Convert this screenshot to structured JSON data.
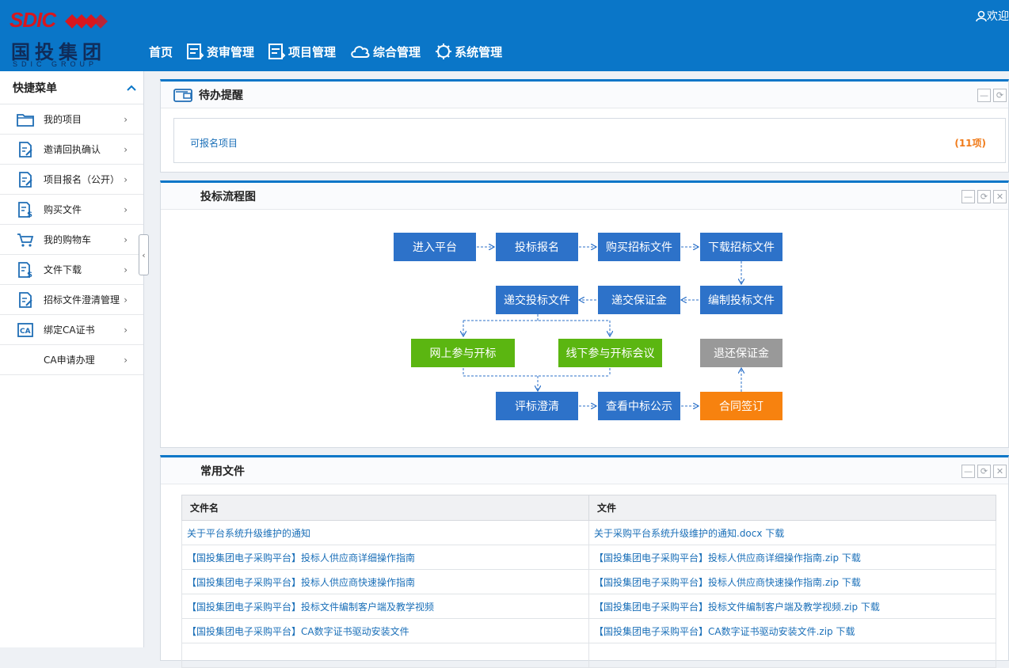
{
  "brand": {
    "name_en": "SDIC",
    "name_cn": "国投集团",
    "sub": "SDIC GROUP"
  },
  "header": {
    "nav": [
      {
        "label": "首页",
        "icon": ""
      },
      {
        "label": "资审管理",
        "icon": "list-icon"
      },
      {
        "label": "项目管理",
        "icon": "list-icon"
      },
      {
        "label": "综合管理",
        "icon": "cloud-icon"
      },
      {
        "label": "系统管理",
        "icon": "gear-icon"
      }
    ],
    "welcome": "欢迎"
  },
  "sidebar": {
    "title": "快捷菜单",
    "items": [
      {
        "label": "我的项目",
        "icon": "folder-icon"
      },
      {
        "label": "邀请回执确认",
        "icon": "edit-doc-icon"
      },
      {
        "label": "项目报名（公开）",
        "icon": "edit-doc-icon"
      },
      {
        "label": "购买文件",
        "icon": "dollar-doc-icon"
      },
      {
        "label": "我的购物车",
        "icon": "cart-icon"
      },
      {
        "label": "文件下载",
        "icon": "dollar-doc-icon"
      },
      {
        "label": "招标文件澄清管理",
        "icon": "edit-doc-icon"
      },
      {
        "label": "绑定CA证书",
        "icon": "ca-icon"
      },
      {
        "label": "CA申请办理",
        "icon": ""
      }
    ]
  },
  "todo": {
    "title": "待办提醒",
    "link": "可报名项目",
    "count": "(11项)"
  },
  "flow": {
    "title": "投标流程图",
    "steps": {
      "s1": "进入平台",
      "s2": "投标报名",
      "s3": "购买招标文件",
      "s4": "下载招标文件",
      "s5": "编制投标文件",
      "s6": "递交保证金",
      "s7": "递交投标文件",
      "s8": "网上参与开标",
      "s9": "线下参与开标会议",
      "s10": "退还保证金",
      "s11": "评标澄清",
      "s12": "查看中标公示",
      "s13": "合同签订"
    },
    "colors": {
      "blue": "#2d72c9",
      "green": "#5bb611",
      "gray": "#999999",
      "orange": "#f7820f"
    }
  },
  "files": {
    "title": "常用文件",
    "columns": [
      "文件名",
      "文件"
    ],
    "rows": [
      [
        "关于平台系统升级维护的通知",
        "关于采购平台系统升级维护的通知.docx 下载"
      ],
      [
        "【国投集团电子采购平台】投标人供应商详细操作指南",
        "【国投集团电子采购平台】投标人供应商详细操作指南.zip 下载"
      ],
      [
        "【国投集团电子采购平台】投标人供应商快速操作指南",
        "【国投集团电子采购平台】投标人供应商快速操作指南.zip 下载"
      ],
      [
        "【国投集团电子采购平台】投标文件编制客户端及教学视频",
        "【国投集团电子采购平台】投标文件编制客户端及教学视频.zip 下载"
      ],
      [
        "【国投集团电子采购平台】CA数字证书驱动安装文件",
        "【国投集团电子采购平台】CA数字证书驱动安装文件.zip 下载"
      ]
    ]
  },
  "theme": {
    "primary": "#0a76c8",
    "link": "#1a6fb8",
    "count": "#f07b1a"
  }
}
